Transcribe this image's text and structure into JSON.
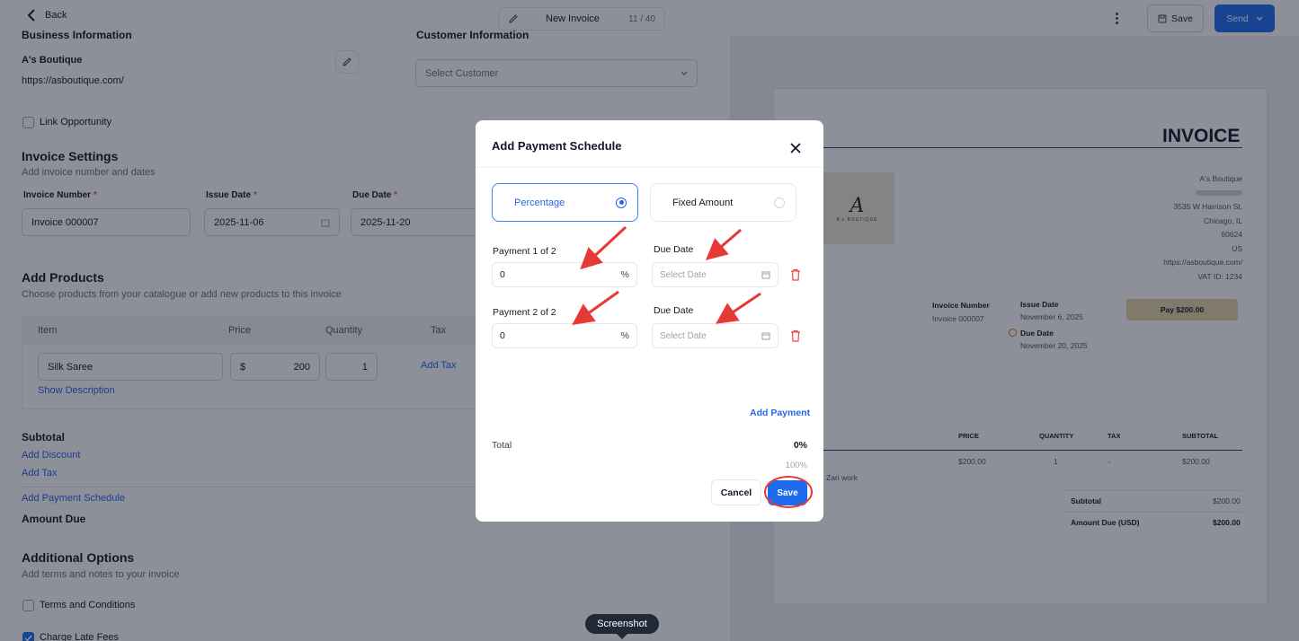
{
  "topbar": {
    "back_label": "Back",
    "title": "New Invoice",
    "title_count": "11 / 40",
    "save_label": "Save",
    "send_label": "Send"
  },
  "form": {
    "business_header_cut": "Business Information",
    "customer_header_cut": "Customer Information",
    "business_name": "A's Boutique",
    "business_url": "https://asboutique.com/",
    "customer_placeholder": "Select Customer",
    "link_opportunity": "Link Opportunity",
    "invoice_settings_title": "Invoice Settings",
    "invoice_settings_sub": "Add invoice number and dates",
    "invoice_number_label": "Invoice Number",
    "issue_date_label": "Issue Date",
    "due_date_label": "Due Date",
    "required_mark": "*",
    "invoice_number_value": "Invoice 000007",
    "issue_date_value": "2025-11-06",
    "due_date_value": "2025-11-20",
    "add_products_title": "Add Products",
    "add_products_sub": "Choose products from your catalogue or add new products to this invoice",
    "columns": {
      "item": "Item",
      "price": "Price",
      "quantity": "Quantity",
      "tax": "Tax"
    },
    "product": {
      "name": "Silk Saree",
      "currency": "$",
      "price": "200",
      "quantity": "1",
      "add_tax": "Add Tax",
      "show_description": "Show Description"
    },
    "subtotal_label": "Subtotal",
    "add_discount": "Add Discount",
    "add_tax": "Add Tax",
    "add_payment_schedule": "Add Payment Schedule",
    "amount_due_label": "Amount Due",
    "additional_options_title": "Additional Options",
    "additional_options_sub": "Add terms and notes to your invoice",
    "terms_label": "Terms and Conditions",
    "late_fees_label": "Charge Late Fees"
  },
  "preview": {
    "heading": "INVOICE",
    "logo_text": "A's BOUTIQUE",
    "business_name": "A's Boutique",
    "address_line1": "3535 W Harrison St,",
    "city": "Chicago, IL",
    "zip": "60624",
    "country": "US",
    "url": "https://asboutique.com/",
    "vat": "VAT ID: 1234",
    "invoice_number_label": "Invoice Number",
    "invoice_number_value": "Invoice 000007",
    "issue_date_label": "Issue Date",
    "issue_date_value": "November 6, 2025",
    "due_date_label": "Due Date",
    "due_date_value": "November 20, 2025",
    "pay_button": "Pay $200.00",
    "table_headers": {
      "price": "PRICE",
      "quantity": "QUANTITY",
      "tax": "TAX",
      "subtotal": "SUBTOTAL"
    },
    "row": {
      "price": "$200.00",
      "quantity": "1",
      "tax": "-",
      "subtotal": "$200.00",
      "description": "Zari work"
    },
    "subtotal_label": "Subtotal",
    "subtotal_value": "$200.00",
    "amount_due_label": "Amount Due (USD)",
    "amount_due_value": "$200.00"
  },
  "modal": {
    "title": "Add Payment Schedule",
    "option_percentage": "Percentage",
    "option_fixed": "Fixed Amount",
    "payment1_label": "Payment 1 of 2",
    "payment2_label": "Payment 2 of 2",
    "due_date_label": "Due Date",
    "payment1_value": "0",
    "payment2_value": "0",
    "percent_suffix": "%",
    "date_placeholder": "Select Date",
    "add_payment": "Add Payment",
    "total_label": "Total",
    "total_value": "0%",
    "total_target": "100%",
    "cancel_label": "Cancel",
    "save_label": "Save"
  },
  "tooltip": "Screenshot",
  "colors": {
    "accent": "#1e6bf0",
    "annotation": "#e53935",
    "link": "#2563eb"
  }
}
